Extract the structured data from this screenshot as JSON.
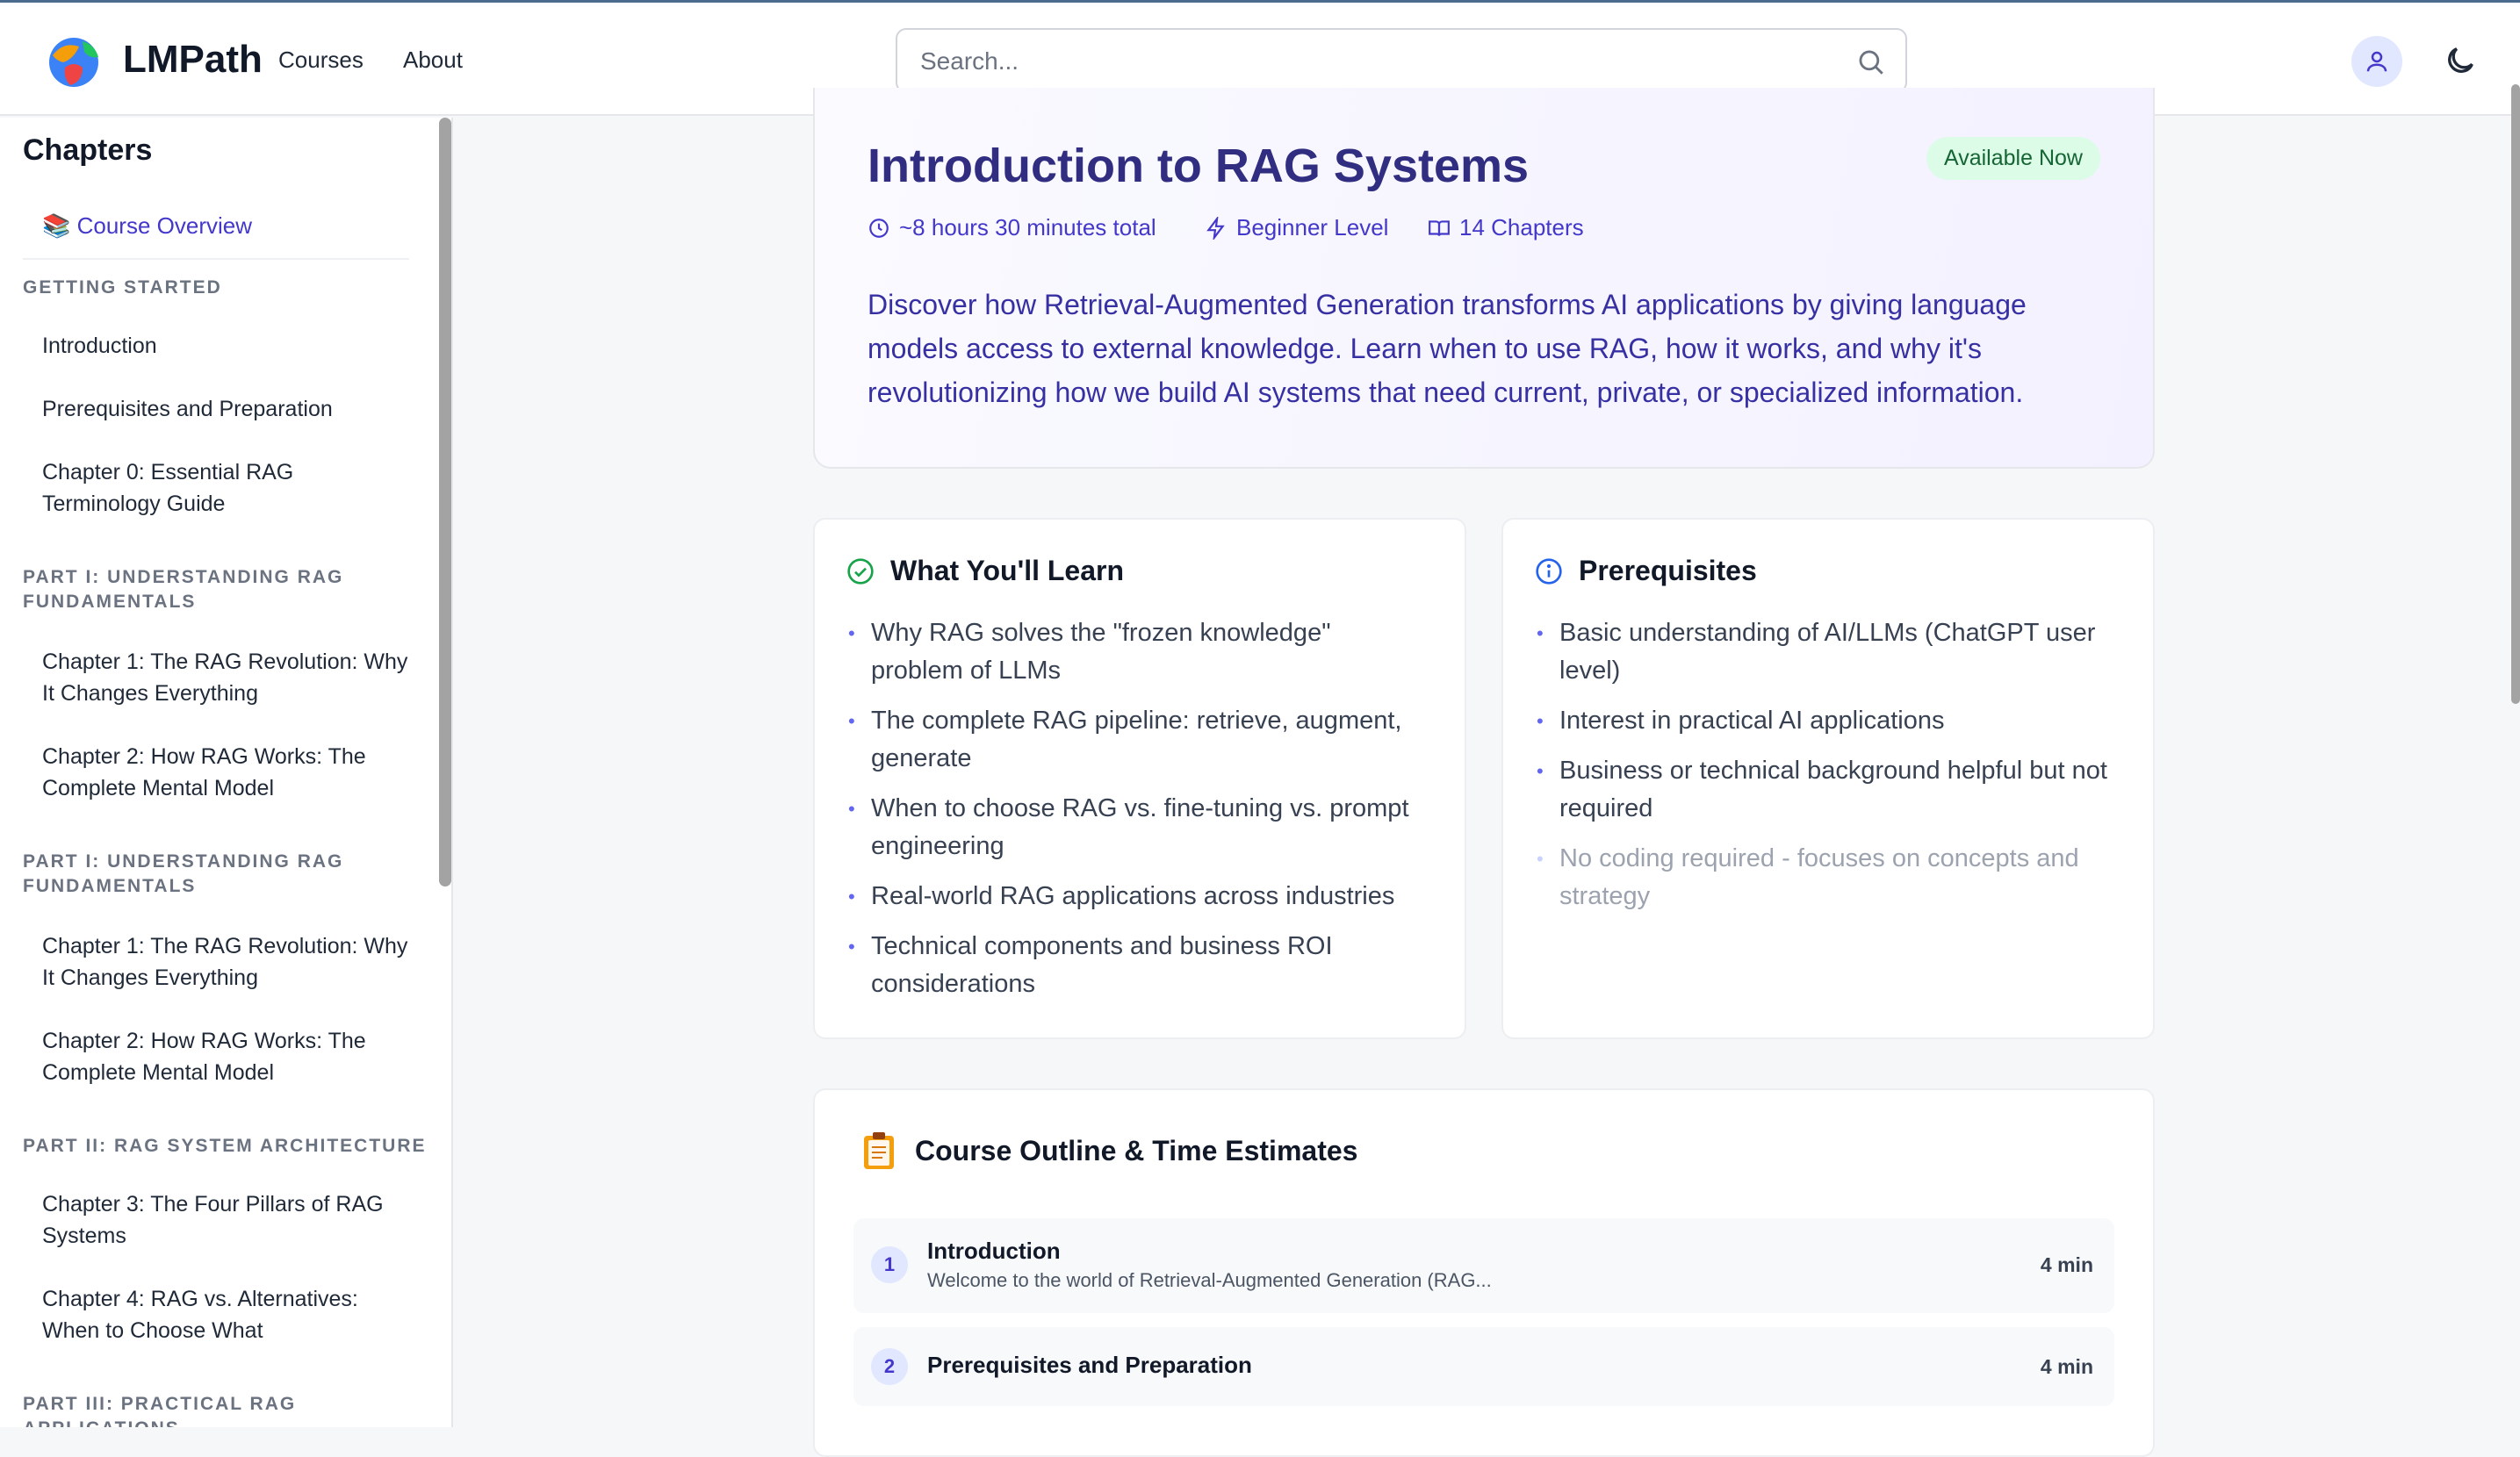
{
  "header": {
    "brand": "LMPath",
    "nav": [
      "Courses",
      "About"
    ],
    "search_placeholder": "Search...",
    "icons": [
      "logo-globe",
      "search-icon",
      "user-icon",
      "moon-icon"
    ]
  },
  "sidebar": {
    "title": "Chapters",
    "overview": "📚 Course Overview",
    "sections": [
      {
        "label": "GETTING STARTED",
        "items": [
          "Introduction",
          "Prerequisites and Preparation",
          "Chapter 0: Essential RAG Terminology Guide"
        ]
      },
      {
        "label": "PART I: UNDERSTANDING RAG FUNDAMENTALS",
        "items": [
          "Chapter 1: The RAG Revolution: Why It Changes Everything",
          "Chapter 2: How RAG Works: The Complete Mental Model"
        ]
      },
      {
        "label": "PART I: UNDERSTANDING RAG FUNDAMENTALS",
        "items": [
          "Chapter 1: The RAG Revolution: Why It Changes Everything",
          "Chapter 2: How RAG Works: The Complete Mental Model"
        ]
      },
      {
        "label": "PART II: RAG SYSTEM ARCHITECTURE",
        "items": [
          "Chapter 3: The Four Pillars of RAG Systems",
          "Chapter 4: RAG vs. Alternatives: When to Choose What"
        ]
      },
      {
        "label": "PART III: PRACTICAL RAG APPLICATIONS",
        "items": []
      }
    ]
  },
  "hero": {
    "title": "Introduction to RAG Systems",
    "badge": "Available Now",
    "duration": "~8 hours 30 minutes total",
    "level": "Beginner Level",
    "chapters": "14 Chapters",
    "description": "Discover how Retrieval-Augmented Generation transforms AI applications by giving language models access to external knowledge. Learn when to use RAG, how it works, and why it's revolutionizing how we build AI systems that need current, private, or specialized information."
  },
  "learn": {
    "title": "What You'll Learn",
    "items": [
      "Why RAG solves the \"frozen knowledge\" problem of LLMs",
      "The complete RAG pipeline: retrieve, augment, generate",
      "When to choose RAG vs. fine-tuning vs. prompt engineering",
      "Real-world RAG applications across industries",
      "Technical components and business ROI considerations"
    ]
  },
  "prereq": {
    "title": "Prerequisites",
    "items": [
      "Basic understanding of AI/LLMs (ChatGPT user level)",
      "Interest in practical AI applications",
      "Business or technical background helpful but not required",
      "No coding required - focuses on concepts and strategy"
    ]
  },
  "outline": {
    "title": "Course Outline & Time Estimates",
    "rows": [
      {
        "num": "1",
        "title": "Introduction",
        "subtitle": "Welcome to the world of Retrieval-Augmented Generation (RAG...",
        "time": "4 min"
      },
      {
        "num": "2",
        "title": "Prerequisites and Preparation",
        "subtitle": "",
        "time": "4 min"
      }
    ]
  },
  "colors": {
    "accent": "#4338ca",
    "badge_bg": "#dcfce7",
    "badge_text": "#166534"
  }
}
